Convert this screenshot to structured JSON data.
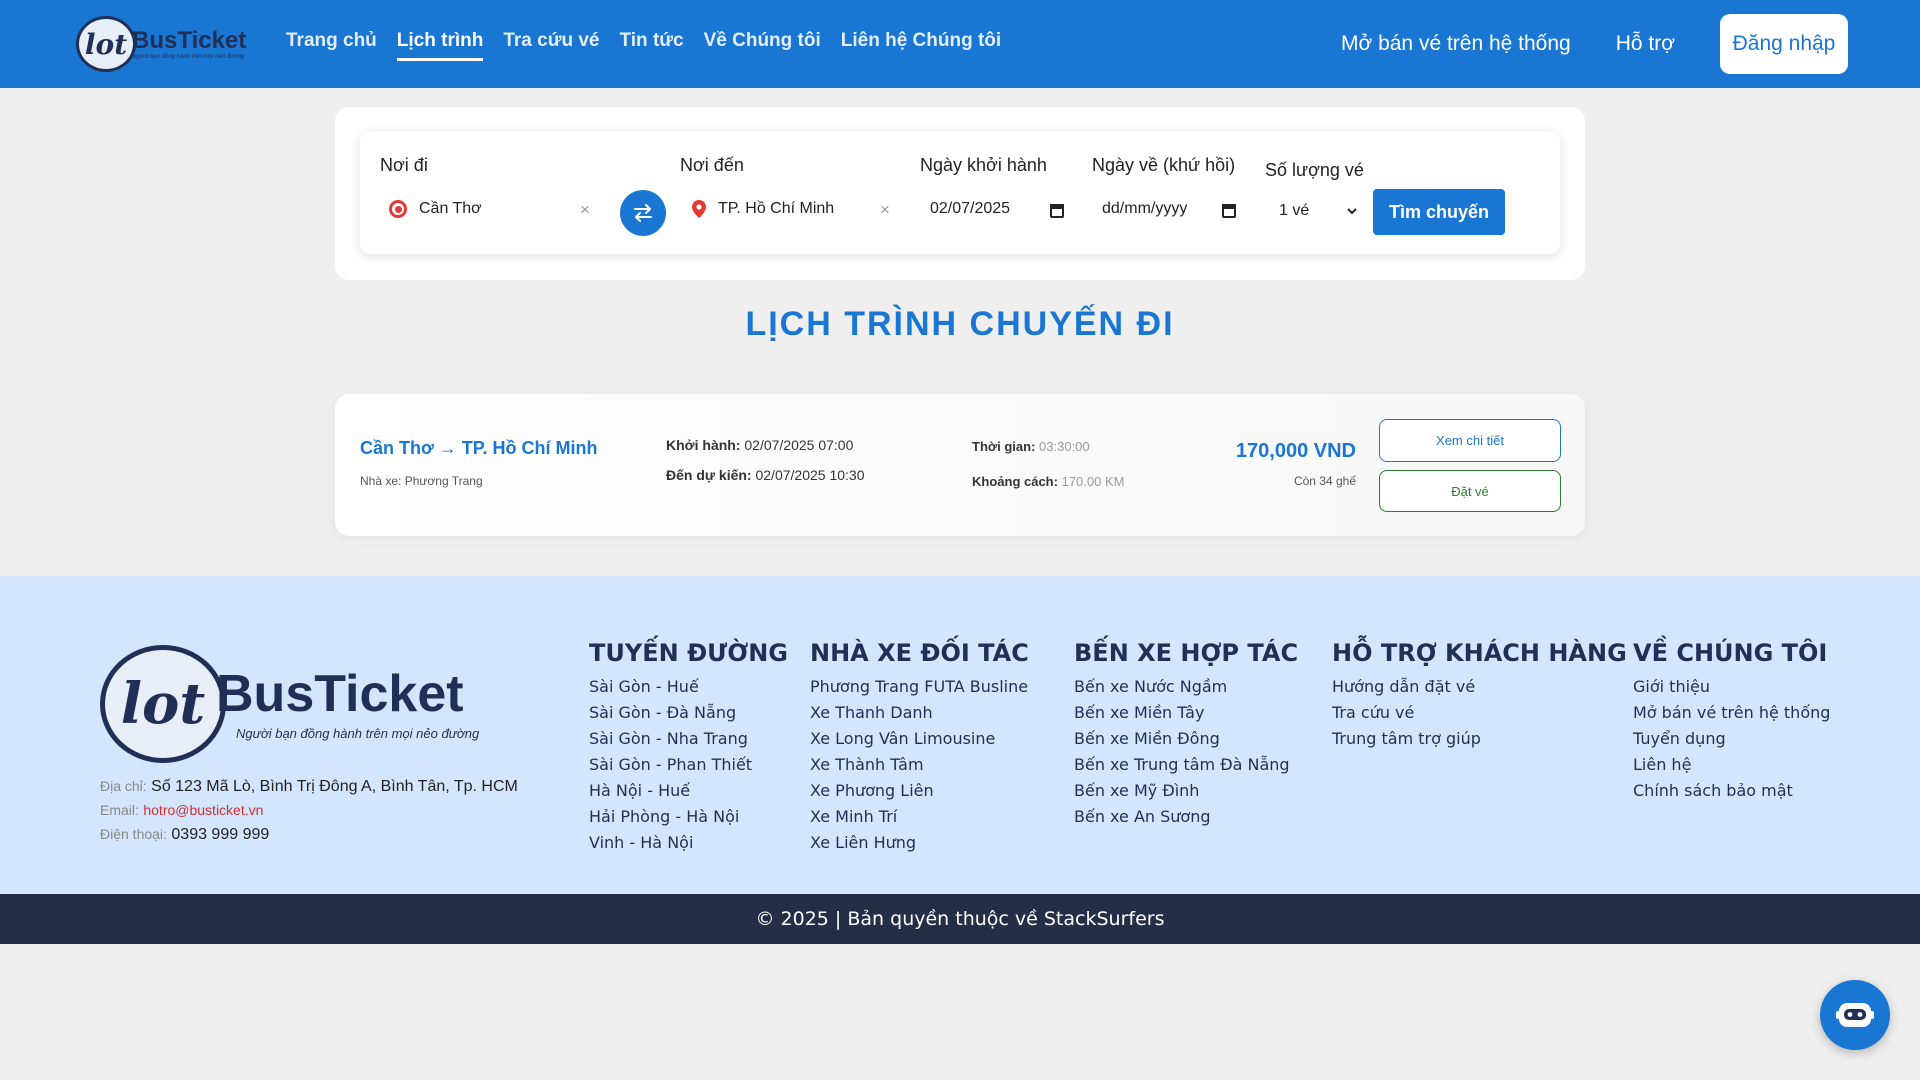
{
  "header": {
    "logo_brand": "BusTicket",
    "logo_tagline": "Người bạn đồng hành trên mọi nẻo đường",
    "nav": [
      "Trang chủ",
      "Lịch trình",
      "Tra cứu vé",
      "Tin tức",
      "Về Chúng tôi",
      "Liên hệ Chúng tôi"
    ],
    "active_nav": "Lịch trình",
    "right_links": [
      "Mở bán vé trên hệ thống",
      "Hỗ trợ"
    ],
    "login_label": "Đăng nhập"
  },
  "search": {
    "origin_label": "Nơi đi",
    "origin_value": "Cần Thơ",
    "destination_label": "Nơi đến",
    "destination_value": "TP. Hồ Chí Minh",
    "depart_label": "Ngày khởi hành",
    "depart_value": "02/07/2025",
    "return_label": "Ngày về (khứ hồi)",
    "return_placeholder": "dd/mm/yyyy",
    "qty_label": "Số lượng vé",
    "qty_value": "1 vé",
    "clear_symbol": "×",
    "search_button": "Tìm chuyến"
  },
  "section_title": "LỊCH TRÌNH CHUYẾN ĐI",
  "trip": {
    "route": "Cần Thơ → TP. Hồ Chí Minh",
    "operator_label": "Nhà xe:",
    "operator": "Phương Trang",
    "depart_label": "Khởi hành:",
    "depart_value": "02/07/2025 07:00",
    "arrive_label": "Đến dự kiến:",
    "arrive_value": "02/07/2025 10:30",
    "duration_label": "Thời gian:",
    "duration_value": "03:30:00",
    "distance_label": "Khoảng cách:",
    "distance_value": "170.00 KM",
    "price": "170,000 VND",
    "seats_left": "Còn 34 ghế",
    "detail_button": "Xem chi tiết",
    "book_button": "Đặt vé"
  },
  "footer": {
    "brand": "BusTicket",
    "tagline": "Người bạn đồng hành trên mọi nẻo đường",
    "address_label": "Địa chỉ:",
    "address": "Số 123 Mã Lò, Bình Trị Đông A, Bình Tân, Tp. HCM",
    "email_label": "Email:",
    "email": "hotro@busticket.vn",
    "phone_label": "Điện thoại:",
    "phone": "0393 999 999",
    "columns": [
      {
        "title": "TUYẾN ĐƯỜNG",
        "items": [
          "Sài Gòn - Huế",
          "Sài Gòn - Đà Nẵng",
          "Sài Gòn - Nha Trang",
          "Sài Gòn - Phan Thiết",
          "Hà Nội - Huế",
          "Hải Phòng - Hà Nội",
          "Vinh - Hà Nội"
        ]
      },
      {
        "title": "NHÀ XE ĐỐI TÁC",
        "items": [
          "Phương Trang FUTA Busline",
          "Xe Thanh Danh",
          "Xe Long Vân Limousine",
          "Xe Thành Tâm",
          "Xe Phương Liên",
          "Xe Minh Trí",
          "Xe Liên Hưng"
        ]
      },
      {
        "title": "BẾN XE HỢP TÁC",
        "items": [
          "Bến xe Nước Ngầm",
          "Bến xe Miền Tây",
          "Bến xe Miền Đông",
          "Bến xe Trung tâm Đà Nẵng",
          "Bến xe Mỹ Đình",
          "Bến xe An Sương"
        ]
      },
      {
        "title": "HỖ TRỢ KHÁCH HÀNG",
        "items": [
          "Hướng dẫn đặt vé",
          "Tra cứu vé",
          "Trung tâm trợ giúp"
        ]
      },
      {
        "title": "VỀ CHÚNG TÔI",
        "items": [
          "Giới thiệu",
          "Mở bán vé trên hệ thống",
          "Tuyển dụng",
          "Liên hệ",
          "Chính sách bảo mật"
        ]
      }
    ],
    "copyright": "© 2025 | Bản quyền thuộc về StackSurfers"
  },
  "colors": {
    "primary": "#1976d2",
    "footer_bg": "#d3e6fd",
    "copyright_bg": "#262d47",
    "book_green": "#2e7d32"
  },
  "icons": {
    "swap": "swap-arrows-icon",
    "origin": "origin-dot-icon",
    "destination": "location-pin-icon",
    "calendar": "calendar-icon",
    "dropdown": "chevron-down-icon",
    "chat": "chatbot-icon"
  }
}
